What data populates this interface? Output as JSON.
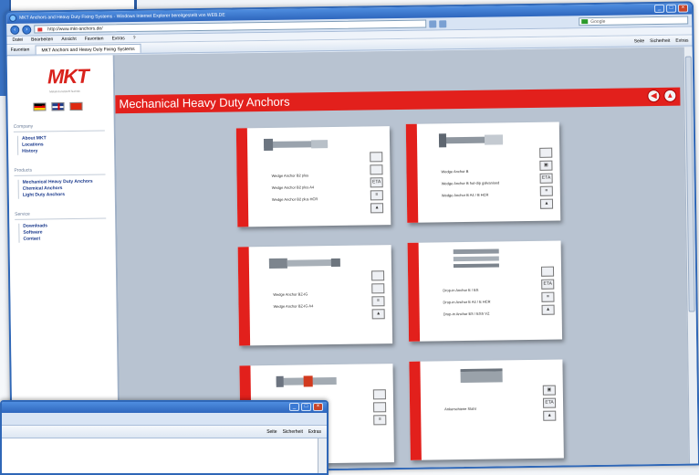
{
  "window": {
    "title": "MKT Anchors and Heavy Duty Fixing Systems - Windows Internet Explorer bereitgestellt von WEB.DE",
    "url": "http://www.mkt-anchors.de/",
    "search_placeholder": "Google",
    "menu": [
      "Datei",
      "Bearbeiten",
      "Ansicht",
      "Favoriten",
      "Extras",
      "?"
    ],
    "favorites_label": "Favoriten",
    "tab_label": "MKT Anchors and Heavy Duty Fixing Systems",
    "tools": [
      "Seite",
      "Sicherheit",
      "Extras"
    ]
  },
  "sidebar": {
    "logo": "MKT",
    "logo_subtitle": "Metall-Kunststoff-Technik",
    "sections": [
      {
        "title": "Company",
        "links": [
          "About MKT",
          "Locations",
          "History"
        ]
      },
      {
        "title": "Products",
        "links": [
          "Mechanical Heavy Duty Anchors",
          "Chemical Anchors",
          "Light Duty Anchors"
        ]
      },
      {
        "title": "Service",
        "links": [
          "Downloads",
          "Software",
          "Contact"
        ]
      }
    ]
  },
  "page": {
    "title": "Mechanical Heavy Duty Anchors",
    "cards": [
      {
        "labels": [
          "Wedge Anchor B2 plus",
          "Wedge Anchor B2 plus A4",
          "Wedge Anchor B2 plus HCR"
        ]
      },
      {
        "labels": [
          "Wedge Anchor B",
          "Wedge Anchor B hot-dip galvanised",
          "Wedge Anchor B A4 / B HCR"
        ]
      },
      {
        "labels": [
          "Wedge Anchor BZ-IG",
          "Wedge Anchor BZ-IG A4"
        ]
      },
      {
        "labels": [
          "Drop-in Anchor E / ES",
          "Drop-in Anchor E A4 / E HCR",
          "Drop-in Anchor ES / ESS VZ"
        ]
      },
      {
        "labels": [
          "",
          "",
          ""
        ]
      },
      {
        "labels": [
          "Ankerschiene Stahl"
        ]
      }
    ]
  },
  "colors": {
    "accent": "#e2201c",
    "chrome": "#2f67b7",
    "content_bg": "#b8c3d1"
  }
}
